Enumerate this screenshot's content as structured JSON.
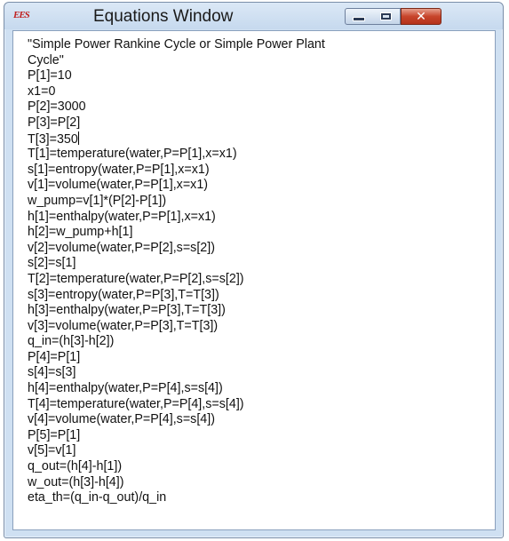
{
  "window": {
    "title": "Equations Window",
    "app_icon": "EES",
    "close_glyph": "✕"
  },
  "editor": {
    "lines": [
      "\"Simple Power Rankine Cycle or Simple Power Plant",
      "Cycle\"",
      "P[1]=10",
      "x1=0",
      "P[2]=3000",
      "P[3]=P[2]",
      "T[3]=350",
      "T[1]=temperature(water,P=P[1],x=x1)",
      "s[1]=entropy(water,P=P[1],x=x1)",
      "v[1]=volume(water,P=P[1],x=x1)",
      "w_pump=v[1]*(P[2]-P[1])",
      "h[1]=enthalpy(water,P=P[1],x=x1)",
      "h[2]=w_pump+h[1]",
      "v[2]=volume(water,P=P[2],s=s[2])",
      "s[2]=s[1]",
      "T[2]=temperature(water,P=P[2],s=s[2])",
      "s[3]=entropy(water,P=P[3],T=T[3])",
      "h[3]=enthalpy(water,P=P[3],T=T[3])",
      "v[3]=volume(water,P=P[3],T=T[3])",
      "q_in=(h[3]-h[2])",
      "P[4]=P[1]",
      "s[4]=s[3]",
      "h[4]=enthalpy(water,P=P[4],s=s[4])",
      "T[4]=temperature(water,P=P[4],s=s[4])",
      "v[4]=volume(water,P=P[4],s=s[4])",
      "P[5]=P[1]",
      "v[5]=v[1]",
      "q_out=(h[4]-h[1])",
      "w_out=(h[3]-h[4])",
      "eta_th=(q_in-q_out)/q_in"
    ],
    "caret_line": 6
  }
}
